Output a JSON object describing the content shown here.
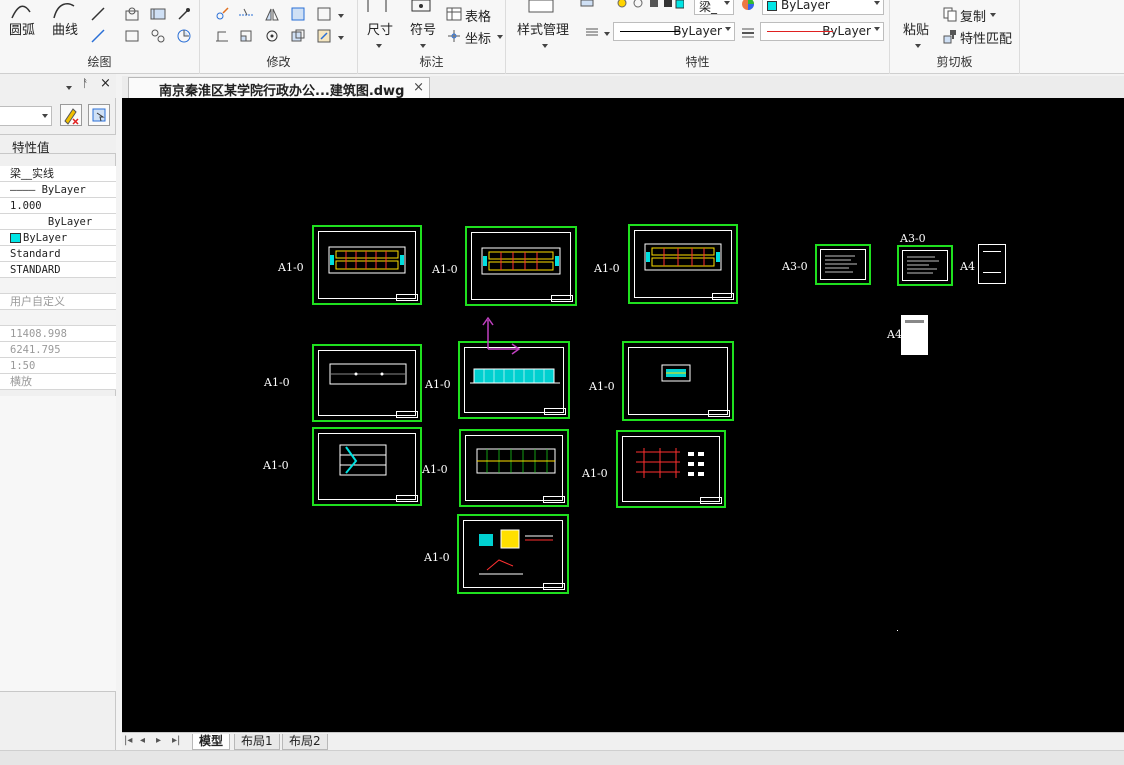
{
  "ribbon": {
    "draw": {
      "title": "绘图",
      "arc_label": "圆弧",
      "curve_label": "曲线"
    },
    "modify": {
      "title": "修改"
    },
    "annotate": {
      "title": "标注",
      "dimension_label": "尺寸",
      "symbol_label": "符号",
      "table_label": "表格",
      "coordinate_label": "坐标"
    },
    "properties": {
      "title": "特性",
      "style_manager_label": "样式管理",
      "layer_value": "梁_",
      "color_value": "ByLayer",
      "linetype_value": "ByLayer",
      "lineweight_value": "ByLayer"
    },
    "clipboard": {
      "title": "剪切板",
      "paste_label": "粘贴",
      "copy_label": "复制",
      "match_label": "特性匹配"
    }
  },
  "panel": {
    "column_header": "特性值",
    "rows": [
      {
        "text": "梁__实线",
        "grey": false
      },
      {
        "text": "———— ByLayer",
        "grey": false,
        "mono": true
      },
      {
        "text": "1.000",
        "grey": false,
        "mono": true
      },
      {
        "text": "      ByLayer",
        "grey": false,
        "mono": true
      },
      {
        "text": "ByLayer",
        "grey": false,
        "mono": true,
        "swatch": "#00e5e5"
      },
      {
        "text": "Standard",
        "grey": false,
        "mono": true
      },
      {
        "text": "STANDARD",
        "grey": false,
        "mono": true
      },
      {
        "text": "",
        "grey": false
      },
      {
        "text": "用户自定义",
        "grey": true
      },
      {
        "text": "",
        "grey": false
      },
      {
        "text": "11408.998",
        "grey": true,
        "mono": true
      },
      {
        "text": "6241.795",
        "grey": true,
        "mono": true
      },
      {
        "text": "1:50",
        "grey": true,
        "mono": true
      },
      {
        "text": "横放",
        "grey": true
      }
    ]
  },
  "document": {
    "tab_title": "南京秦淮区某学院行政办公...建筑图.dwg",
    "close_glyph": "×"
  },
  "sheets": [
    {
      "label": "A1-0"
    },
    {
      "label": "A1-0"
    },
    {
      "label": "A1-0"
    },
    {
      "label": "A1-0"
    },
    {
      "label": "A1-0"
    },
    {
      "label": "A1-0"
    },
    {
      "label": "A1-0"
    },
    {
      "label": "A1-0"
    },
    {
      "label": "A1-0"
    },
    {
      "label": "A1-0"
    },
    {
      "label": "A3-0"
    },
    {
      "label": "A3-0"
    },
    {
      "label": "A4"
    },
    {
      "label": "A4"
    }
  ],
  "layout_tabs": [
    {
      "label": "模型",
      "active": true
    },
    {
      "label": "布局1",
      "active": false
    },
    {
      "label": "布局2",
      "active": false
    }
  ],
  "nav_glyphs": [
    "|◂",
    "◂",
    "▸",
    "▸|"
  ],
  "colors": {
    "sheet_border": "#1fe01f",
    "canvas_bg": "#000000",
    "ucs_icon": "#c040c0",
    "plan_fill": "#00d0d0"
  }
}
